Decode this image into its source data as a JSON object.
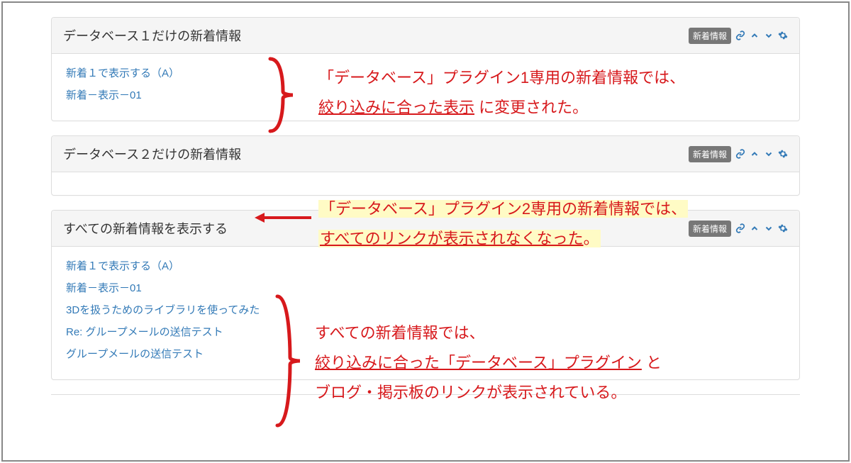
{
  "panel1": {
    "title": "データベース１だけの新着情報",
    "badge": "新着情報",
    "links": [
      "新着１で表示する（A）",
      "新着－表示－01"
    ]
  },
  "panel2": {
    "title": "データベース２だけの新着情報",
    "badge": "新着情報",
    "links": []
  },
  "panel3": {
    "title": "すべての新着情報を表示する",
    "badge": "新着情報",
    "links": [
      "新着１で表示する（A）",
      "新着－表示－01",
      "3Dを扱うためのライブラリを使ってみた",
      "Re: グループメールの送信テスト",
      "グループメールの送信テスト"
    ]
  },
  "annotation1": {
    "prefix": "「データベース」プラグイン1専用の新着情報では、",
    "underlined": "絞り込みに合った表示",
    "suffix": " に変更された。"
  },
  "annotation2": {
    "prefix": "「データベース」プラグイン2専用の新着情報では、",
    "underlined": "すべてのリンクが表示されなくなった",
    "suffix": "。"
  },
  "annotation3": {
    "line1": "すべての新着情報では、",
    "underlined": "絞り込みに合った「データベース」プラグイン",
    "mid": " と",
    "line3": "ブログ・掲示板のリンクが表示されている。"
  },
  "icons": {
    "link": "link",
    "up": "up",
    "down": "down",
    "gear": "gear"
  }
}
